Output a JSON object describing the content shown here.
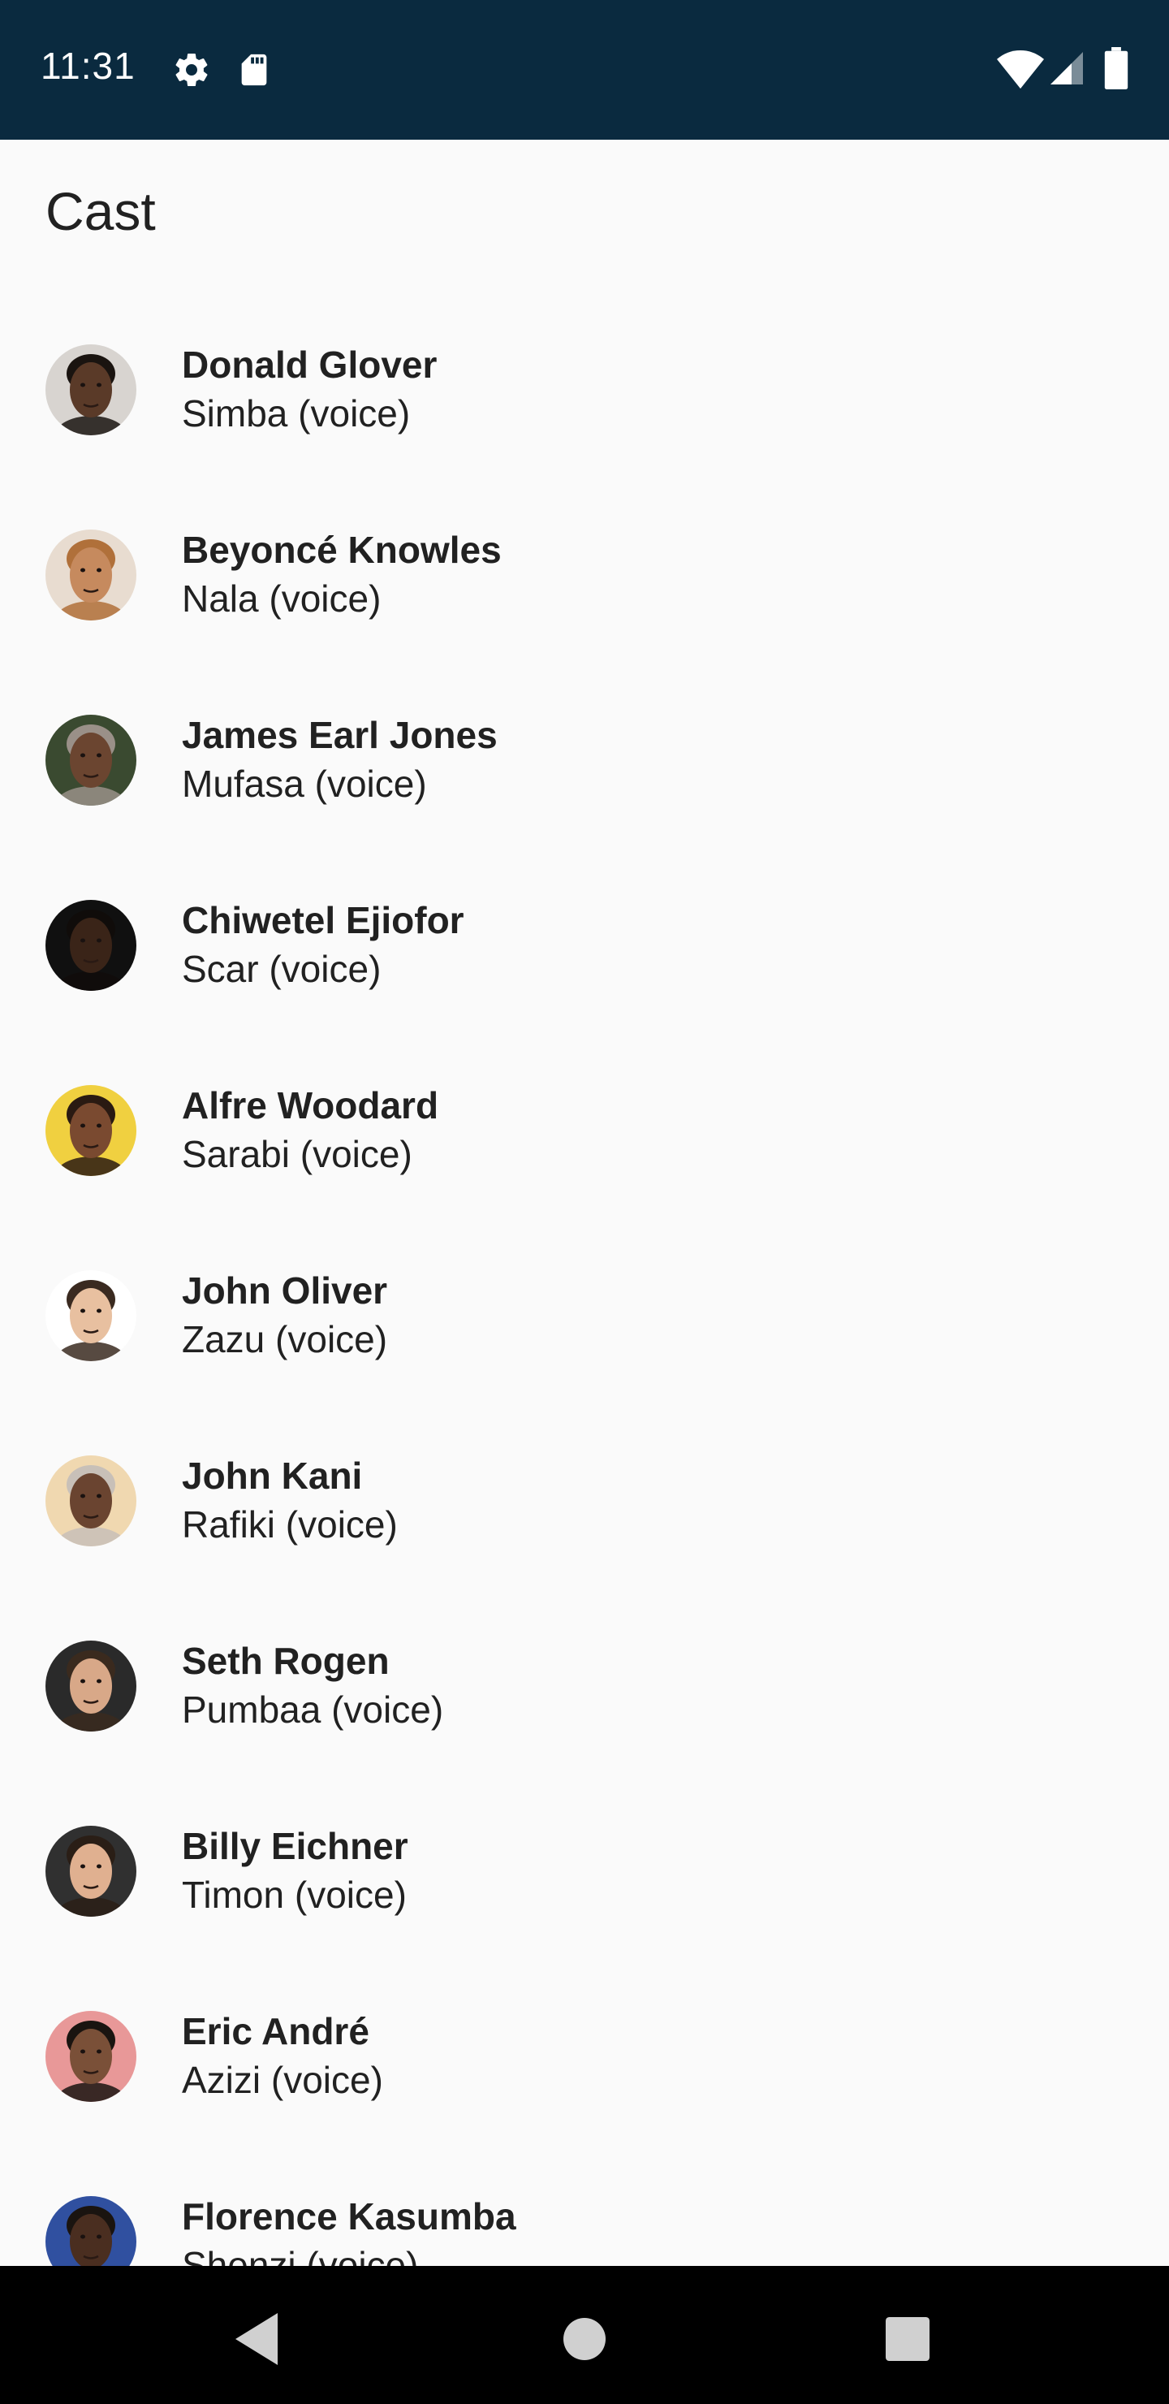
{
  "status_bar": {
    "time": "11:31",
    "icons": [
      "gear-icon",
      "sd-card-icon",
      "wifi-icon",
      "signal-icon",
      "battery-icon"
    ],
    "background": "#0a2a3f"
  },
  "page": {
    "title": "Cast"
  },
  "cast": [
    {
      "name": "Donald Glover",
      "role": "Simba (voice)",
      "avatar": "avatar-photo",
      "skin": "#5a3a28",
      "hair": "#1a1410",
      "bg": "#d8d4d0"
    },
    {
      "name": "Beyoncé Knowles",
      "role": "Nala (voice)",
      "avatar": "avatar-photo",
      "skin": "#c68a5e",
      "hair": "#b0703a",
      "bg": "#e8dcd0"
    },
    {
      "name": "James Earl Jones",
      "role": "Mufasa (voice)",
      "avatar": "avatar-photo",
      "skin": "#6b4530",
      "hair": "#9a9088",
      "bg": "#3a4a30"
    },
    {
      "name": "Chiwetel Ejiofor",
      "role": "Scar (voice)",
      "avatar": "avatar-photo",
      "skin": "#3a2418",
      "hair": "#100c0a",
      "bg": "#101010"
    },
    {
      "name": "Alfre Woodard",
      "role": "Sarabi (voice)",
      "avatar": "avatar-photo",
      "skin": "#7a4a30",
      "hair": "#2a1a12",
      "bg": "#f0d040"
    },
    {
      "name": "John Oliver",
      "role": "Zazu (voice)",
      "avatar": "avatar-photo",
      "skin": "#e8c0a0",
      "hair": "#3a2a20",
      "bg": "#ffffff"
    },
    {
      "name": "John Kani",
      "role": "Rafiki (voice)",
      "avatar": "avatar-photo",
      "skin": "#6a4430",
      "hair": "#c8c0b8",
      "bg": "#f0d8b0"
    },
    {
      "name": "Seth Rogen",
      "role": "Pumbaa (voice)",
      "avatar": "avatar-photo",
      "skin": "#d8a888",
      "hair": "#3a2a1e",
      "bg": "#2a2a2a"
    },
    {
      "name": "Billy Eichner",
      "role": "Timon (voice)",
      "avatar": "avatar-photo",
      "skin": "#e0b090",
      "hair": "#2a1e16",
      "bg": "#303030"
    },
    {
      "name": "Eric André",
      "role": "Azizi (voice)",
      "avatar": "avatar-photo",
      "skin": "#7a5038",
      "hair": "#1a1410",
      "bg": "#e89898"
    },
    {
      "name": "Florence Kasumba",
      "role": "Shenzi (voice)",
      "avatar": "avatar-photo",
      "skin": "#4a2e20",
      "hair": "#1a1410",
      "bg": "#3050a0"
    }
  ],
  "nav_bar": {
    "buttons": [
      "back-icon",
      "home-icon",
      "recents-icon"
    ]
  }
}
